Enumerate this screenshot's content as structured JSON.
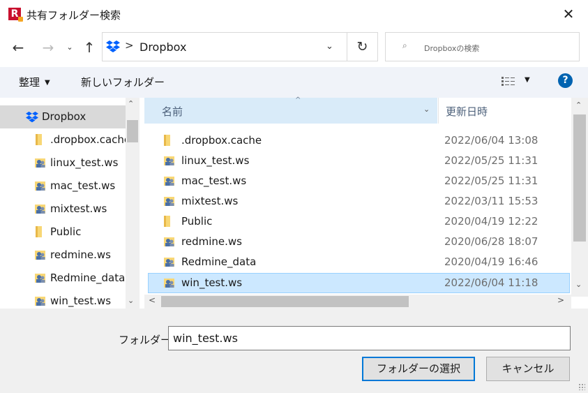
{
  "window": {
    "title": "共有フォルダー検索",
    "close_glyph": "✕"
  },
  "nav": {
    "back_glyph": "←",
    "forward_glyph": "→",
    "recent_glyph": "⌄",
    "up_glyph": "↑",
    "address_separator": ">",
    "address_location": "Dropbox",
    "address_dropdown_glyph": "⌄",
    "refresh_glyph": "↻",
    "search_placeholder": "Dropboxの検索",
    "search_icon_glyph": "⌕"
  },
  "toolbar": {
    "organize_label": "整理",
    "organize_arrow": "▼",
    "new_folder_label": "新しいフォルダー",
    "view_arrow": "▼",
    "help_label": "?"
  },
  "sidebar": {
    "scroll_up": "⌃",
    "scroll_down": "⌄",
    "items": [
      {
        "label": "Dropbox",
        "icon": "dropbox-icon",
        "selected": true
      },
      {
        "label": ".dropbox.cache",
        "icon": "folder-icon"
      },
      {
        "label": "linux_test.ws",
        "icon": "shared-folder-icon"
      },
      {
        "label": "mac_test.ws",
        "icon": "shared-folder-icon"
      },
      {
        "label": "mixtest.ws",
        "icon": "shared-folder-icon"
      },
      {
        "label": "Public",
        "icon": "folder-icon"
      },
      {
        "label": "redmine.ws",
        "icon": "shared-folder-icon"
      },
      {
        "label": "Redmine_data",
        "icon": "shared-folder-icon"
      },
      {
        "label": "win_test.ws",
        "icon": "shared-folder-icon"
      }
    ]
  },
  "filelist": {
    "columns": {
      "name": "名前",
      "date": "更新日時"
    },
    "sort_glyph": "^",
    "column_dropdown_glyph": "⌄",
    "scroll_up": "⌃",
    "scroll_down": "⌄",
    "scroll_left": "<",
    "scroll_right": ">",
    "rows": [
      {
        "name": ".dropbox.cache",
        "date": "2022/06/04 13:08",
        "icon": "folder-icon"
      },
      {
        "name": "linux_test.ws",
        "date": "2022/05/25 11:31",
        "icon": "shared-folder-icon"
      },
      {
        "name": "mac_test.ws",
        "date": "2022/05/25 11:31",
        "icon": "shared-folder-icon"
      },
      {
        "name": "mixtest.ws",
        "date": "2022/03/11 15:53",
        "icon": "shared-folder-icon"
      },
      {
        "name": "Public",
        "date": "2020/04/19 12:22",
        "icon": "folder-icon"
      },
      {
        "name": "redmine.ws",
        "date": "2020/06/28 18:07",
        "icon": "shared-folder-icon"
      },
      {
        "name": "Redmine_data",
        "date": "2020/04/19 16:46",
        "icon": "shared-folder-icon"
      },
      {
        "name": "win_test.ws",
        "date": "2022/06/04 11:18",
        "icon": "shared-folder-icon",
        "selected": true
      }
    ]
  },
  "footer": {
    "folder_label": "フォルダー:",
    "folder_value": "win_test.ws",
    "select_button": "フォルダーの選択",
    "cancel_button": "キャンセル"
  },
  "colors": {
    "accent": "#0078d7",
    "selection": "#cce8ff",
    "header_highlight": "#d9ebf9",
    "dropbox_blue": "#0061fe",
    "folder_yellow": "#f8d775"
  }
}
